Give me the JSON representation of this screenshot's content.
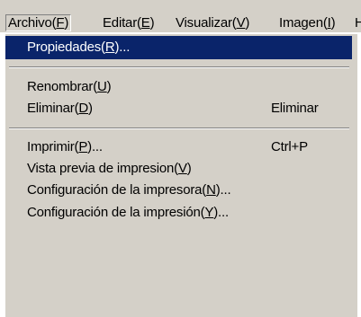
{
  "menubar": {
    "items": [
      {
        "text": "Archivo(",
        "key": "F",
        "end": ")"
      },
      {
        "text": "Editar(",
        "key": "E",
        "end": ")"
      },
      {
        "text": "Visualizar(",
        "key": "V",
        "end": ")"
      },
      {
        "text": "Imagen(",
        "key": "I",
        "end": ")"
      },
      {
        "text": "H",
        "key": "",
        "end": ""
      }
    ]
  },
  "menu": {
    "items": [
      {
        "text": "Propiedades(",
        "key": "R",
        "end": ")...",
        "shortcut": ""
      },
      {
        "text": "Renombrar(",
        "key": "U",
        "end": ")",
        "shortcut": ""
      },
      {
        "text": "Eliminar(",
        "key": "D",
        "end": ")",
        "shortcut": "Eliminar"
      },
      {
        "text": "Imprimir(",
        "key": "P",
        "end": ")...",
        "shortcut": "Ctrl+P"
      },
      {
        "text": "Vista previa de impresion(",
        "key": "V",
        "end": ")",
        "shortcut": ""
      },
      {
        "text": "Configuración de la impresora(",
        "key": "N",
        "end": ")...",
        "shortcut": ""
      },
      {
        "text": "Configuración de la impresión(",
        "key": "Y",
        "end": ")...",
        "shortcut": ""
      }
    ]
  },
  "colors": {
    "menu_background": "#d4d0c8",
    "highlight_background": "#0a246a",
    "highlight_text": "#ffffff"
  }
}
